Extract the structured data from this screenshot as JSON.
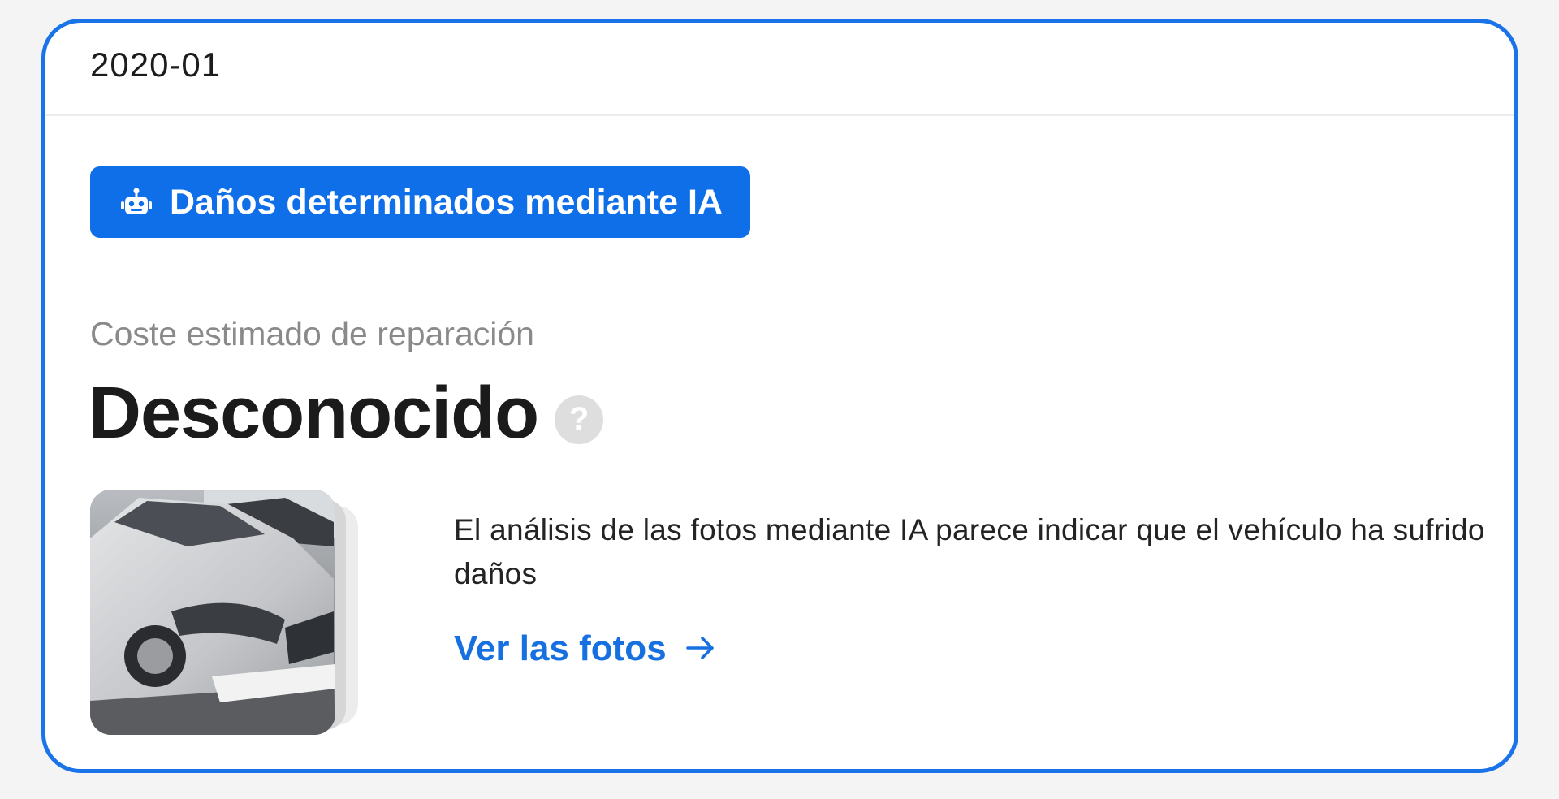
{
  "card": {
    "date": "2020-01",
    "badge_label": "Daños determinados mediante IA",
    "badge_icon": "robot-icon",
    "cost_label": "Coste estimado de reparación",
    "cost_value": "Desconocido",
    "help_icon": "question-mark-icon",
    "help_glyph": "?",
    "description": "El análisis de las fotos mediante IA parece indicar que el vehículo ha sufrido daños",
    "link_label": "Ver las fotos",
    "link_icon": "arrow-right-icon",
    "thumbnail": "damaged-car-photo"
  },
  "colors": {
    "accent": "#0f6fe8",
    "border": "#1a73e8",
    "link": "#1670e0",
    "muted_text": "#8a8a8a"
  }
}
